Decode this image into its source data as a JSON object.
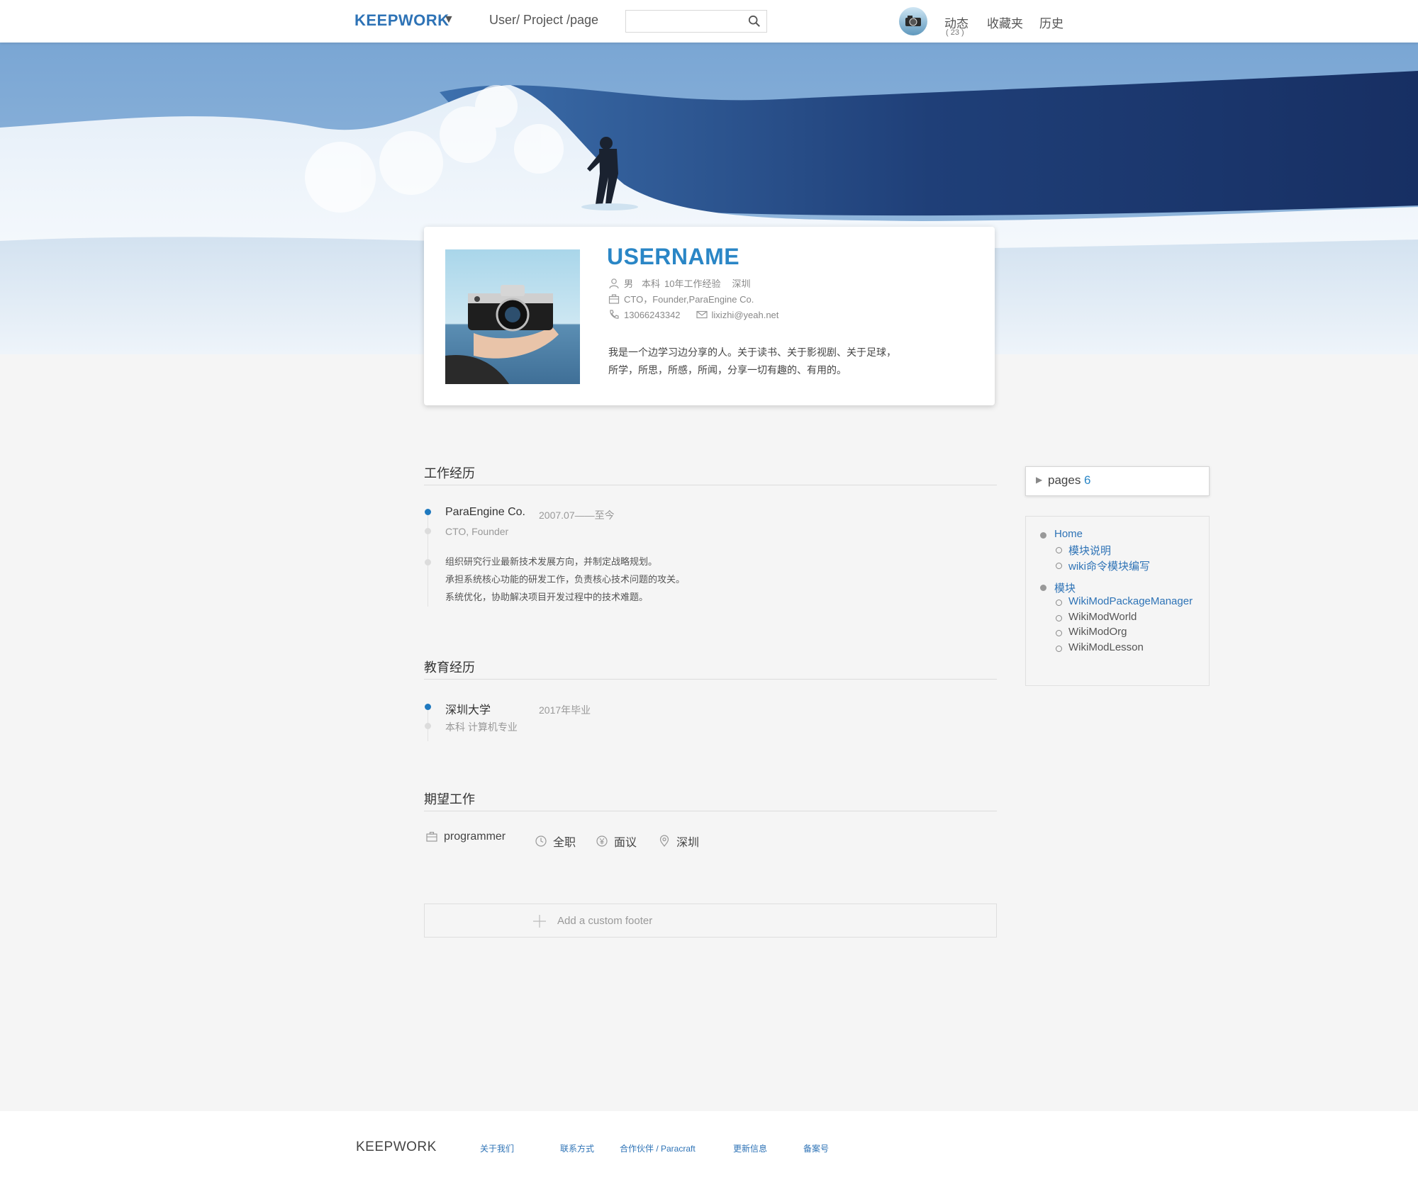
{
  "header": {
    "logo": "KEEPWORK",
    "logo_caret": "▼",
    "breadcrumb": "User/  Project /page",
    "search": {
      "value": "",
      "placeholder": ""
    },
    "nav": {
      "activity_label": "动态",
      "activity_count": "( 23 )",
      "favorites_label": "收藏夹",
      "history_label": "历史"
    }
  },
  "profile": {
    "username": "USERNAME",
    "gender": "男",
    "education": "本科",
    "experience": "10年工作经验",
    "city": "深圳",
    "position": "CTO，Founder,ParaEngine Co.",
    "phone": "13066243342",
    "email": "lixizhi@yeah.net",
    "bio_line1": "我是一个边学习边分享的人。关于读书、关于影视剧、关于足球，",
    "bio_line2": "所学，所思，所感，所闻，分享一切有趣的、有用的。"
  },
  "work": {
    "title": "工作经历",
    "entries": [
      {
        "company": "ParaEngine Co.",
        "date": "2007.07——至今",
        "role": "CTO, Founder",
        "desc": [
          "组织研究行业最新技术发展方向，并制定战略规划。",
          "承担系统核心功能的研发工作，负责核心技术问题的攻关。",
          "系统优化，协助解决项目开发过程中的技术难题。"
        ]
      }
    ]
  },
  "education": {
    "title": "教育经历",
    "entries": [
      {
        "school": "深圳大学",
        "date": "2017年毕业",
        "major": "本科  计算机专业"
      }
    ]
  },
  "expectation": {
    "title": "期望工作",
    "job": "programmer",
    "type": "全职",
    "salary": "面议",
    "city": "深圳"
  },
  "custom_footer": {
    "label": "Add a custom footer"
  },
  "sidebar": {
    "pages_label": "pages",
    "pages_count": "6",
    "toc": [
      {
        "label": "Home",
        "children": [
          "模块说明",
          "wiki命令模块编写"
        ]
      },
      {
        "label": "模块",
        "children": [
          "WikiModPackageManager",
          "WikiModWorld",
          "WikiModOrg",
          "WikiModLesson"
        ]
      }
    ]
  },
  "footer": {
    "logo": "KEEPWORK",
    "links": [
      "关于我们",
      "联系方式",
      "合作伙伴 / Paracraft",
      "更新信息",
      "备案号"
    ]
  },
  "colors": {
    "accent": "#2e73b6",
    "username": "#2a86c6",
    "timeline_dot": "#1f79bf",
    "background": "#f5f5f5"
  }
}
